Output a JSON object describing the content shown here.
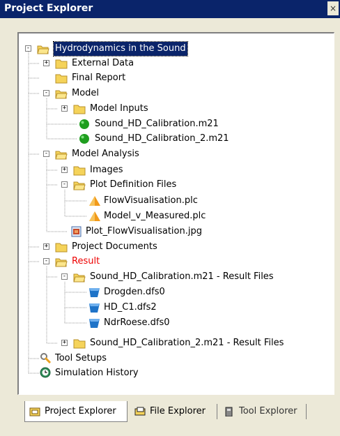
{
  "window": {
    "title": "Project Explorer",
    "close_symbol": "×"
  },
  "tree": {
    "root": "Hydrodynamics in the Sound",
    "external_data": "External Data",
    "final_report": "Final Report",
    "model": "Model",
    "model_inputs": "Model Inputs",
    "model_file_1": "Sound_HD_Calibration.m21",
    "model_file_2": "Sound_HD_Calibration_2.m21",
    "model_analysis": "Model Analysis",
    "images": "Images",
    "plot_definition_files": "Plot Definition Files",
    "plot_file_1": "FlowVisualisation.plc",
    "plot_file_2": "Model_v_Measured.plc",
    "plot_image": "Plot_FlowVisualisation.jpg",
    "project_documents": "Project Documents",
    "result": "Result",
    "result_files_1": "Sound_HD_Calibration.m21 - Result Files",
    "dfs_1": "Drogden.dfs0",
    "dfs_2": "HD_C1.dfs2",
    "dfs_3": "NdrRoese.dfs0",
    "result_files_2": "Sound_HD_Calibration_2.m21 - Result Files",
    "tool_setups": "Tool Setups",
    "simulation_history": "Simulation History"
  },
  "tabs": {
    "project_explorer": "Project Explorer",
    "file_explorer": "File Explorer",
    "tool_explorer": "Tool Explorer"
  },
  "colors": {
    "title_bg": "#0a246a",
    "folder": "#f5d35a",
    "result_text": "#e00000",
    "green_ball": "#1f9e1f",
    "dfs_blue": "#1e73c8",
    "plc_orange": "#f19a1a"
  }
}
